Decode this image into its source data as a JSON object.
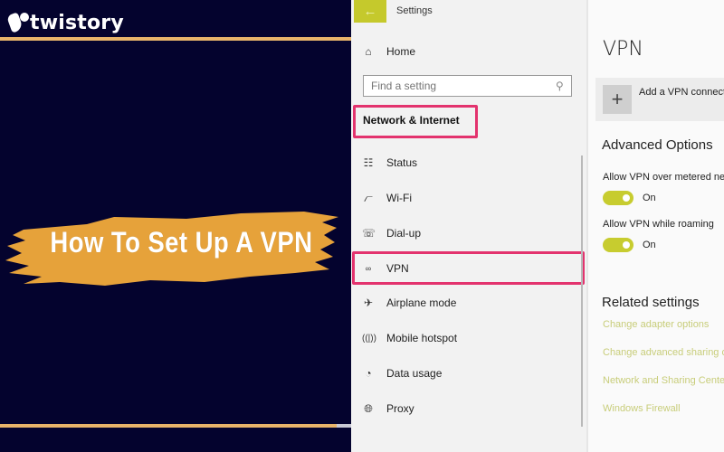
{
  "banner": {
    "brand": "twistory",
    "headline": "How To Set Up A VPN",
    "colors": {
      "background": "#04032e",
      "accent": "#e8b46a",
      "brush": "#e6a23a"
    }
  },
  "settings": {
    "window_title": "Settings",
    "back_icon": "arrow-left-icon",
    "home_label": "Home",
    "search_placeholder": "Find a setting",
    "section_title": "Network & Internet",
    "nav_items": [
      {
        "label": "Status",
        "icon": "globe-monitor-icon"
      },
      {
        "label": "Wi-Fi",
        "icon": "wifi-icon"
      },
      {
        "label": "Dial-up",
        "icon": "phone-icon"
      },
      {
        "label": "VPN",
        "icon": "vpn-icon"
      },
      {
        "label": "Airplane mode",
        "icon": "airplane-icon"
      },
      {
        "label": "Mobile hotspot",
        "icon": "hotspot-icon"
      },
      {
        "label": "Data usage",
        "icon": "pie-icon"
      },
      {
        "label": "Proxy",
        "icon": "globe-icon"
      }
    ],
    "accent_color": "#c5c92c",
    "highlight_color": "#e3336e"
  },
  "vpn_page": {
    "title": "VPN",
    "add_label": "Add a VPN connection",
    "advanced_title": "Advanced Options",
    "options": [
      {
        "label": "Allow VPN over metered networks",
        "state": "On"
      },
      {
        "label": "Allow VPN while roaming",
        "state": "On"
      }
    ],
    "related_title": "Related settings",
    "related_links": [
      "Change adapter options",
      "Change advanced sharing options",
      "Network and Sharing Center",
      "Windows Firewall"
    ]
  }
}
